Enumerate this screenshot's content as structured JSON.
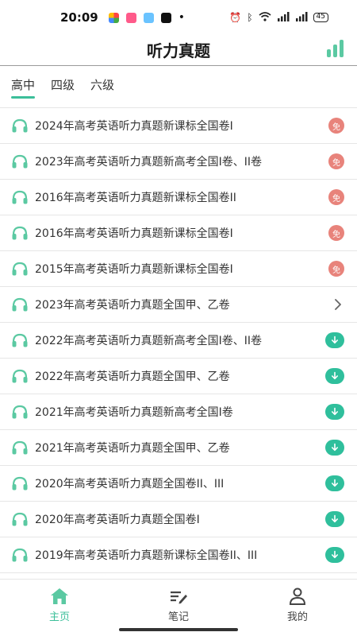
{
  "status": {
    "time": "20:09",
    "dot": "•",
    "battery": "45"
  },
  "header": {
    "title": "听力真题"
  },
  "tabs": [
    {
      "label": "高中"
    },
    {
      "label": "四级"
    },
    {
      "label": "六级"
    }
  ],
  "list": {
    "free_label": "免",
    "items": [
      {
        "title": "2024年高考英语听力真题新课标全国卷I",
        "action": "free"
      },
      {
        "title": "2023年高考英语听力真题新高考全国I卷、II卷",
        "action": "free"
      },
      {
        "title": "2016年高考英语听力真题新课标全国卷II",
        "action": "free"
      },
      {
        "title": "2016年高考英语听力真题新课标全国卷I",
        "action": "free"
      },
      {
        "title": "2015年高考英语听力真题新课标全国卷I",
        "action": "free"
      },
      {
        "title": "2023年高考英语听力真题全国甲、乙卷",
        "action": "open"
      },
      {
        "title": "2022年高考英语听力真题新高考全国I卷、II卷",
        "action": "download"
      },
      {
        "title": "2022年高考英语听力真题全国甲、乙卷",
        "action": "download"
      },
      {
        "title": "2021年高考英语听力真题新高考全国I卷",
        "action": "download"
      },
      {
        "title": "2021年高考英语听力真题全国甲、乙卷",
        "action": "download"
      },
      {
        "title": "2020年高考英语听力真题全国卷II、III",
        "action": "download"
      },
      {
        "title": "2020年高考英语听力真题全国卷I",
        "action": "download"
      },
      {
        "title": "2019年高考英语听力真题新课标全国卷II、III",
        "action": "download"
      }
    ]
  },
  "nav": [
    {
      "label": "主页",
      "icon": "home-icon"
    },
    {
      "label": "笔记",
      "icon": "notes-icon"
    },
    {
      "label": "我的",
      "icon": "profile-icon"
    }
  ],
  "colors": {
    "accent": "#3cbf9a",
    "free_badge": "#e8837b",
    "download": "#2fbf9c"
  }
}
